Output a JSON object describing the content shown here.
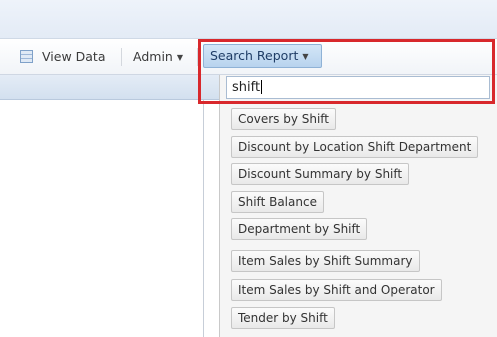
{
  "toolbar": {
    "view_data_label": "View Data",
    "admin_label": "Admin",
    "search_report_label": "Search Report"
  },
  "search": {
    "value": "shift"
  },
  "results": [
    "Covers by Shift",
    "Discount by Location Shift Department",
    "Discount Summary by Shift",
    "Shift Balance",
    "Department by Shift",
    "Item Sales by Shift Summary",
    "Item Sales by Shift and Operator",
    "Tender by Shift"
  ],
  "colors": {
    "highlight_border": "#d8282c",
    "active_button": "#c6ddf3"
  }
}
